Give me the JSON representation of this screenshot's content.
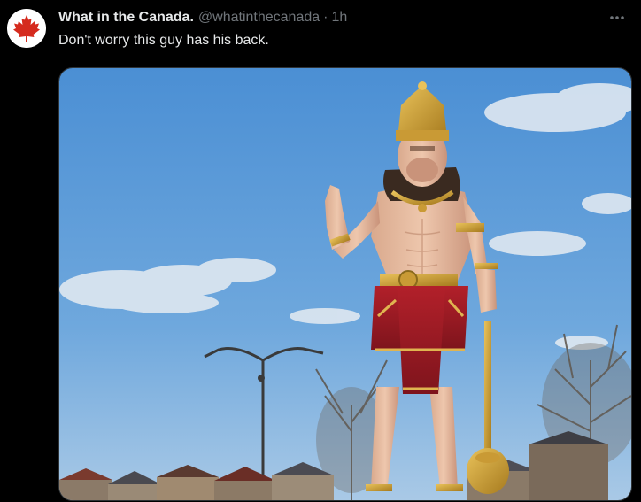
{
  "tweet": {
    "display_name": "What in the Canada.",
    "handle": "@whatinthecanada",
    "separator": "·",
    "time": "1h",
    "text": "Don't worry this guy has his back.",
    "more_label": "···"
  },
  "avatar": {
    "icon": "maple-leaf-icon",
    "color": "#d52b1e"
  },
  "colors": {
    "background": "#000000",
    "primary_text": "#e7e9ea",
    "secondary_text": "#71767b",
    "border": "#2f3336"
  }
}
